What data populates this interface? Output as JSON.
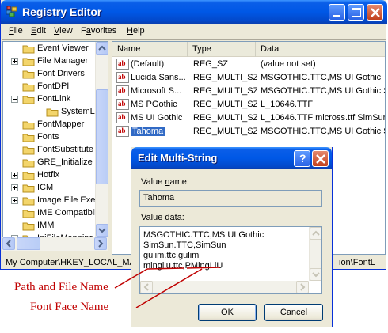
{
  "window": {
    "title": "Registry Editor"
  },
  "menu": {
    "items": [
      {
        "accel": "F",
        "rest": "ile"
      },
      {
        "accel": "E",
        "rest": "dit"
      },
      {
        "accel": "V",
        "rest": "iew"
      },
      {
        "accel": "",
        "prefix": "F",
        "mid": "a",
        "rest": "vorites"
      },
      {
        "accel": "H",
        "rest": "elp"
      }
    ]
  },
  "tree": {
    "items": [
      {
        "label": "Event Viewer",
        "expander": "none"
      },
      {
        "label": "File Manager",
        "expander": "plus"
      },
      {
        "label": "Font Drivers",
        "expander": "none"
      },
      {
        "label": "FontDPI",
        "expander": "none"
      },
      {
        "label": "FontLink",
        "expander": "minus"
      },
      {
        "label": "SystemLink",
        "expander": "none",
        "child": true
      },
      {
        "label": "FontMapper",
        "expander": "none"
      },
      {
        "label": "Fonts",
        "expander": "none"
      },
      {
        "label": "FontSubstitute",
        "expander": "none"
      },
      {
        "label": "GRE_Initialize",
        "expander": "none"
      },
      {
        "label": "Hotfix",
        "expander": "plus"
      },
      {
        "label": "ICM",
        "expander": "plus"
      },
      {
        "label": "Image File Exec",
        "expander": "plus"
      },
      {
        "label": "IME Compatibili",
        "expander": "none"
      },
      {
        "label": "IMM",
        "expander": "none"
      },
      {
        "label": "IniFileMapping",
        "expander": "plus"
      }
    ]
  },
  "list": {
    "headers": {
      "name": "Name",
      "type": "Type",
      "data": "Data"
    },
    "rows": [
      {
        "name": "(Default)",
        "type": "REG_SZ",
        "data": "(value not set)"
      },
      {
        "name": "Lucida Sans...",
        "type": "REG_MULTI_SZ",
        "data": "MSGOTHIC.TTC,MS UI Gothic"
      },
      {
        "name": "Microsoft S...",
        "type": "REG_MULTI_SZ",
        "data": "MSGOTHIC.TTC,MS UI Gothic Sir"
      },
      {
        "name": "MS PGothic",
        "type": "REG_MULTI_SZ",
        "data": "L_10646.TTF"
      },
      {
        "name": "MS UI Gothic",
        "type": "REG_MULTI_SZ",
        "data": "L_10646.TTF micross.ttf SimSun"
      },
      {
        "name": "Tahoma",
        "type": "REG_MULTI_SZ",
        "data": "MSGOTHIC.TTC,MS UI Gothic Sir",
        "selected": true
      }
    ]
  },
  "status": {
    "left": "My Computer\\HKEY_LOCAL_MAC",
    "right": "ion\\FontL"
  },
  "dialog": {
    "title": "Edit Multi-String",
    "help_glyph": "?",
    "value_name_label_accel": "n",
    "value_name_label_pre": "Value ",
    "value_name_label_post": "ame:",
    "value_name": "Tahoma",
    "value_data_label_pre": "Value ",
    "value_data_label_accel": "d",
    "value_data_label_post": "ata:",
    "lines": [
      "MSGOTHIC.TTC,MS UI Gothic",
      "SimSun.TTC,SimSun",
      "gulim.ttc,gulim",
      "mingliu.ttc,PMingLiU"
    ],
    "ok_label": "OK",
    "cancel_label": "Cancel"
  },
  "annotations": {
    "path": "Path and File Name",
    "face": "Font Face Name",
    "color": "#c00000"
  },
  "colors": {
    "title_blue": "#0058e6",
    "selection": "#316ac5",
    "close_red": "#c1401d"
  }
}
